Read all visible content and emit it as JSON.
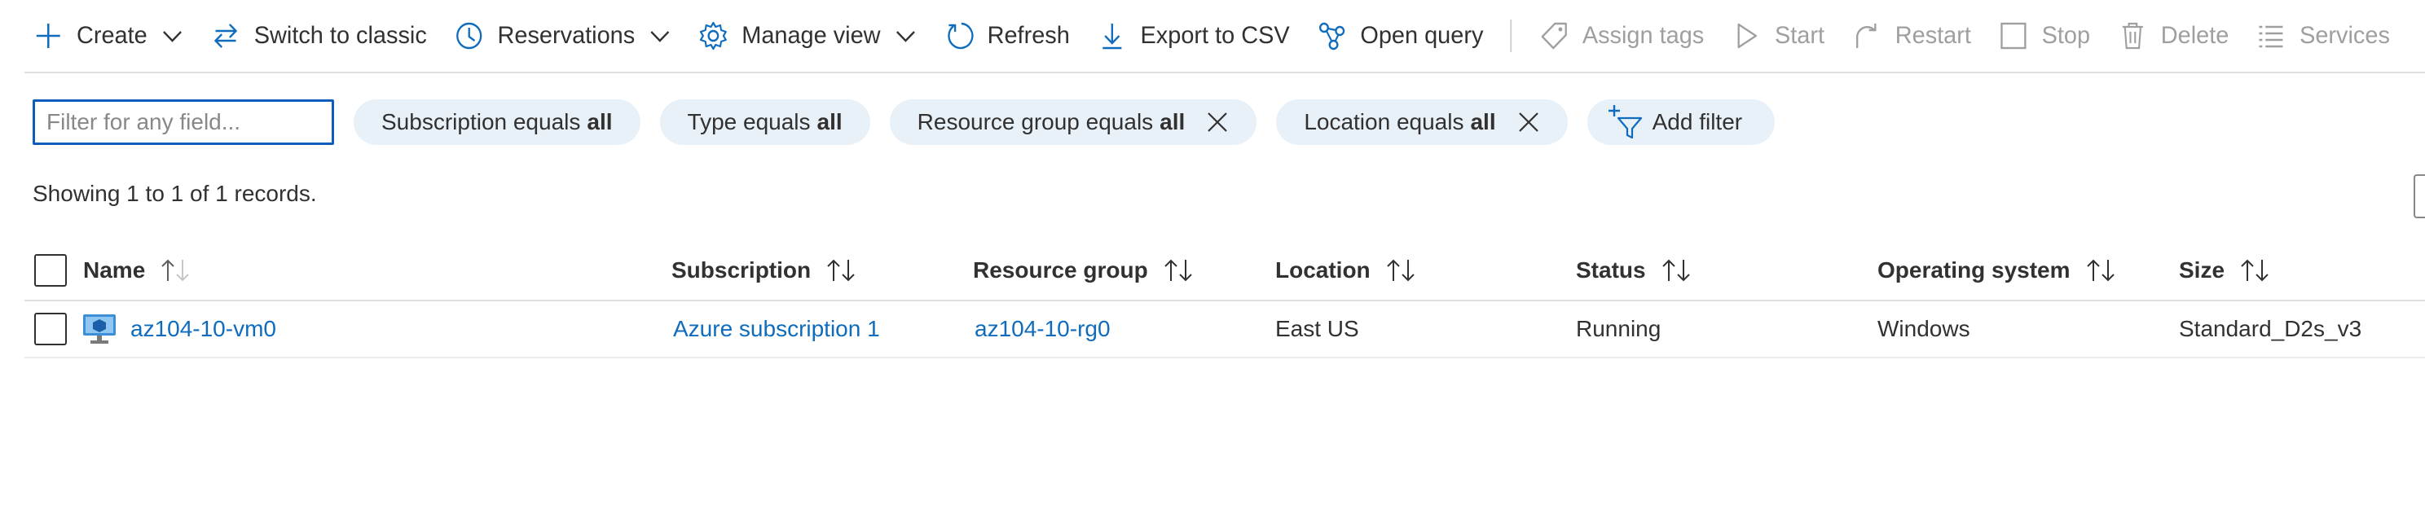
{
  "toolbar": {
    "create": "Create",
    "switch_classic": "Switch to classic",
    "reservations": "Reservations",
    "manage_view": "Manage view",
    "refresh": "Refresh",
    "export_csv": "Export to CSV",
    "open_query": "Open query",
    "assign_tags": "Assign tags",
    "start": "Start",
    "restart": "Restart",
    "stop": "Stop",
    "delete": "Delete",
    "services": "Services"
  },
  "filters": {
    "placeholder": "Filter for any field...",
    "subscription": {
      "label": "Subscription equals",
      "value": "all"
    },
    "type": {
      "label": "Type equals",
      "value": "all"
    },
    "resource_group": {
      "label": "Resource group equals",
      "value": "all"
    },
    "location": {
      "label": "Location equals",
      "value": "all"
    },
    "add_filter": "Add filter"
  },
  "records_text": "Showing 1 to 1 of 1 records.",
  "columns": {
    "name": "Name",
    "subscription": "Subscription",
    "resource_group": "Resource group",
    "location": "Location",
    "status": "Status",
    "os": "Operating system",
    "size": "Size"
  },
  "rows": [
    {
      "name": "az104-10-vm0",
      "subscription": "Azure subscription 1",
      "resource_group": "az104-10-rg0",
      "location": "East US",
      "status": "Running",
      "os": "Windows",
      "size": "Standard_D2s_v3"
    }
  ],
  "icons": {
    "create": "plus-icon",
    "switch_classic": "switch-arrows-icon",
    "reservations": "clock-icon",
    "manage_view": "gear-icon",
    "refresh": "refresh-icon",
    "export_csv": "download-icon",
    "open_query": "query-graph-icon",
    "assign_tags": "tag-icon",
    "start": "play-icon",
    "restart": "restart-icon",
    "stop": "stop-icon",
    "delete": "trash-icon",
    "services": "list-icon",
    "vm": "virtual-machine-icon"
  },
  "colors": {
    "accent": "#0f6cbd",
    "pill_bg": "#e8f0f8",
    "disabled": "#a19f9d"
  }
}
